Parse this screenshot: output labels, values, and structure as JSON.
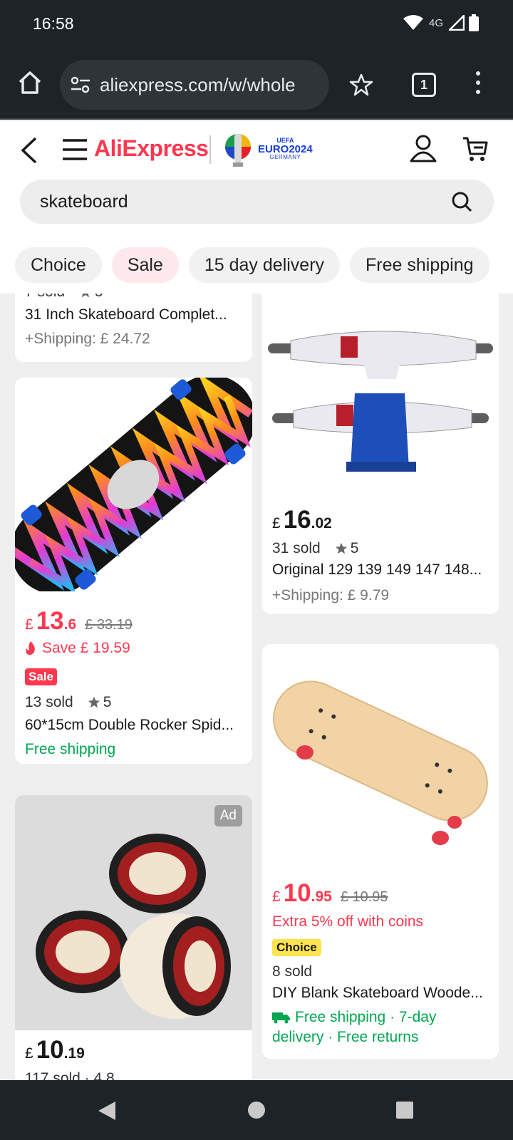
{
  "status_bar": {
    "time": "16:58",
    "network": "4G"
  },
  "browser": {
    "url": "aliexpress.com/w/whole",
    "tab_count": "1"
  },
  "header": {
    "logo": "AliExpress",
    "euro_badge": {
      "uefa": "UEFA",
      "title": "EURO2024",
      "country": "GERMANY"
    }
  },
  "search": {
    "value": "skateboard"
  },
  "filters": [
    "Choice",
    "Sale",
    "15 day delivery",
    "Free shipping"
  ],
  "products": {
    "p1": {
      "sold": "7 sold",
      "rating": "5",
      "title": "31 Inch Skateboard Complet...",
      "shipping": "+Shipping:  £ 24.72"
    },
    "p2": {
      "currency": "£",
      "price_int": "13",
      "price_dec": ".6",
      "orig": "£ 33.19",
      "save": "Save  £ 19.59",
      "badge": "Sale",
      "sold": "13 sold",
      "rating": "5",
      "title": "60*15cm Double Rocker Spid...",
      "delivery": "Free shipping"
    },
    "p3": {
      "currency": "£",
      "price_int": "10",
      "price_dec": ".19",
      "ad": "Ad",
      "sold_partial": "117 sold  · 4.8"
    },
    "p4": {
      "currency": "£",
      "price_int": "16",
      "price_dec": ".02",
      "sold": "31 sold",
      "rating": "5",
      "title": "Original 129 139 149 147 148...",
      "shipping": "+Shipping:  £ 9.79"
    },
    "p5": {
      "currency": "£",
      "price_int": "10",
      "price_dec": ".95",
      "orig": "£ 10.95",
      "promo": "Extra 5% off with coins",
      "badge": "Choice",
      "sold": "8 sold",
      "title": "DIY Blank Skateboard Woode...",
      "delivery_line1": "Free shipping · 7-day",
      "delivery_line2": "delivery · Free returns"
    }
  },
  "colors": {
    "brand": "#fd384f",
    "green": "#00a650",
    "choice": "#ffe34f",
    "chrome": "#1d2327"
  }
}
